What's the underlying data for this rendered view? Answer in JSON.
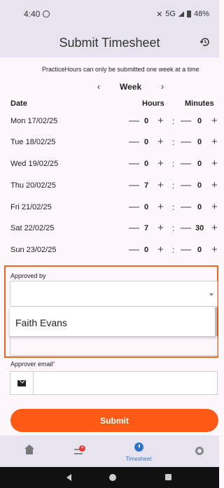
{
  "status_bar": {
    "time": "4:40",
    "network": "5G",
    "battery": "48%"
  },
  "app_bar": {
    "title": "Submit Timesheet"
  },
  "notice": "PracticeHours can only be submitted one week at a time",
  "week_nav": {
    "prev": "‹",
    "label": "Week",
    "next": "›"
  },
  "columns": {
    "date": "Date",
    "hours": "Hours",
    "minutes": "Minutes"
  },
  "controls": {
    "minus": "—",
    "plus": "+",
    "colon": ":"
  },
  "days": [
    {
      "label": "Mon 17/02/25",
      "hours": "0",
      "minutes": "0"
    },
    {
      "label": "Tue  18/02/25",
      "hours": "0",
      "minutes": "0"
    },
    {
      "label": "Wed 19/02/25",
      "hours": "0",
      "minutes": "0"
    },
    {
      "label": "Thu  20/02/25",
      "hours": "7",
      "minutes": "0"
    },
    {
      "label": "Fri   21/02/25",
      "hours": "0",
      "minutes": "0"
    },
    {
      "label": "Sat  22/02/25",
      "hours": "7",
      "minutes": "30"
    },
    {
      "label": "Sun  23/02/25",
      "hours": "0",
      "minutes": "0"
    }
  ],
  "approved_by": {
    "label": "Approved by",
    "value": "",
    "options": [
      "Faith Evans"
    ]
  },
  "approver_email": {
    "label": "Approver email",
    "required_mark": "*",
    "value": ""
  },
  "submit_label": "Submit",
  "bottom_nav": {
    "home": "home-icon",
    "inbox": {
      "icon": "inbox-icon",
      "badge": "4"
    },
    "timesheet": {
      "icon": "clock-icon",
      "label": "Timesheet"
    },
    "settings": "gear-icon"
  },
  "colors": {
    "accent": "#fc5a16",
    "primary": "#2f73c9",
    "bar_bg": "#e7e4ef",
    "page_bg": "#fdf7fb"
  }
}
